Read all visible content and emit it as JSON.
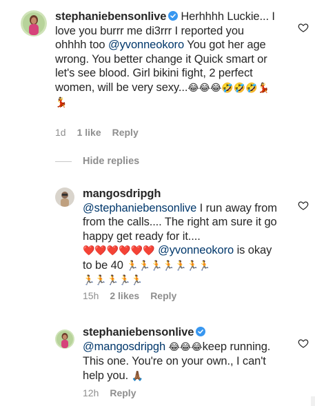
{
  "comments": [
    {
      "username": "stephaniebensonlive",
      "text_parts": [
        "Herhhhh Luckie... I love you burrr me di3rrr I reported you ohhhh too ",
        "@yvonneokoro",
        " You got her age wrong. You better change it Quick smart or let's see blood. Girl  bikini fight, 2 perfect women, will be very sexy..."
      ],
      "emojis": "😂😂😂🤣🤣🤣💃💃",
      "emojis_line2": "💃💃",
      "time": "1d",
      "likes": "1 like",
      "reply": "Reply"
    },
    {
      "username": "mangosdripgh",
      "mention1": "@stephaniebensonlive",
      "text1": " I run away from from the calls.... The right am sure it go happy get ready for it....",
      "hearts": "❤️❤️❤️❤️❤️❤️",
      "mention2": "@yvonneokoro",
      "text2": " is okay to be 40 ",
      "runners1": "🏃🏃🏃🏃🏃🏃🏃",
      "runners2": "🏃🏃🏃🏃🏃",
      "time": "15h",
      "likes": "2 likes",
      "reply": "Reply"
    },
    {
      "username": "stephaniebensonlive",
      "mention": "@mangosdripgh",
      "emojis": "😂😂😂",
      "text": "keep running. This one. You're on your own., I can't help you.",
      "pray": "🙏🏾",
      "time": "12h",
      "reply": "Reply"
    }
  ],
  "hide_replies": "Hide replies",
  "colors": {
    "mention": "#00376b",
    "meta": "#8e8e8e",
    "verified": "#3897f0",
    "heart_red": "#e0245e"
  }
}
